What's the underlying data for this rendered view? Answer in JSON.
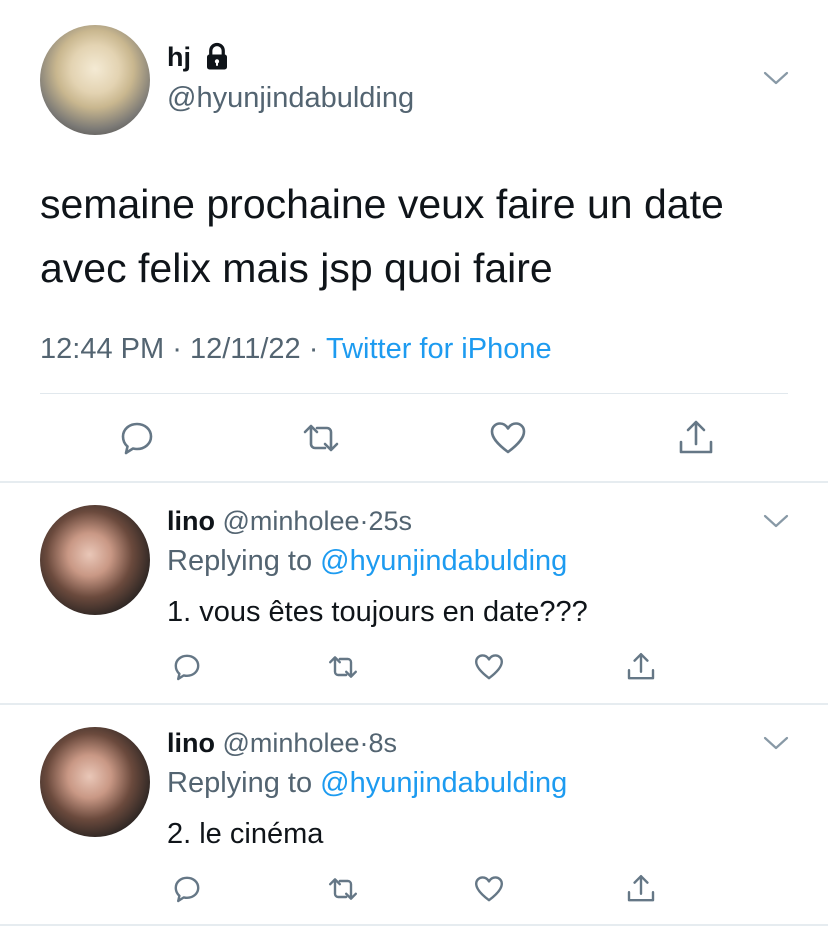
{
  "main_tweet": {
    "display_name": "hj",
    "handle": "@hyunjindabulding",
    "text_line1": "semaine prochaine veux faire un date",
    "text_line2": "avec felix mais jsp quoi faire",
    "time": "12:44 PM",
    "date": "12/11/22",
    "separator": "·",
    "source": "Twitter for iPhone",
    "icons": {
      "lock": "lock-icon",
      "reply": "reply-icon",
      "retweet": "retweet-icon",
      "like": "heart-icon",
      "share": "share-icon",
      "menu": "chevron-down-icon"
    }
  },
  "replies": [
    {
      "display_name": "lino",
      "handle": "@minholee",
      "separator": "·",
      "age": "25s",
      "replying_prefix": "Replying to",
      "replying_to": "@hyunjindabulding",
      "text": "1. vous êtes toujours en date???"
    },
    {
      "display_name": "lino",
      "handle": "@minholee",
      "separator": "·",
      "age": "8s",
      "replying_prefix": "Replying to",
      "replying_to": "@hyunjindabulding",
      "text": "2. le cinéma"
    }
  ],
  "colors": {
    "text": "#0f1419",
    "secondary": "#536471",
    "link": "#1d9bf0",
    "divider": "#e1e8ed"
  }
}
